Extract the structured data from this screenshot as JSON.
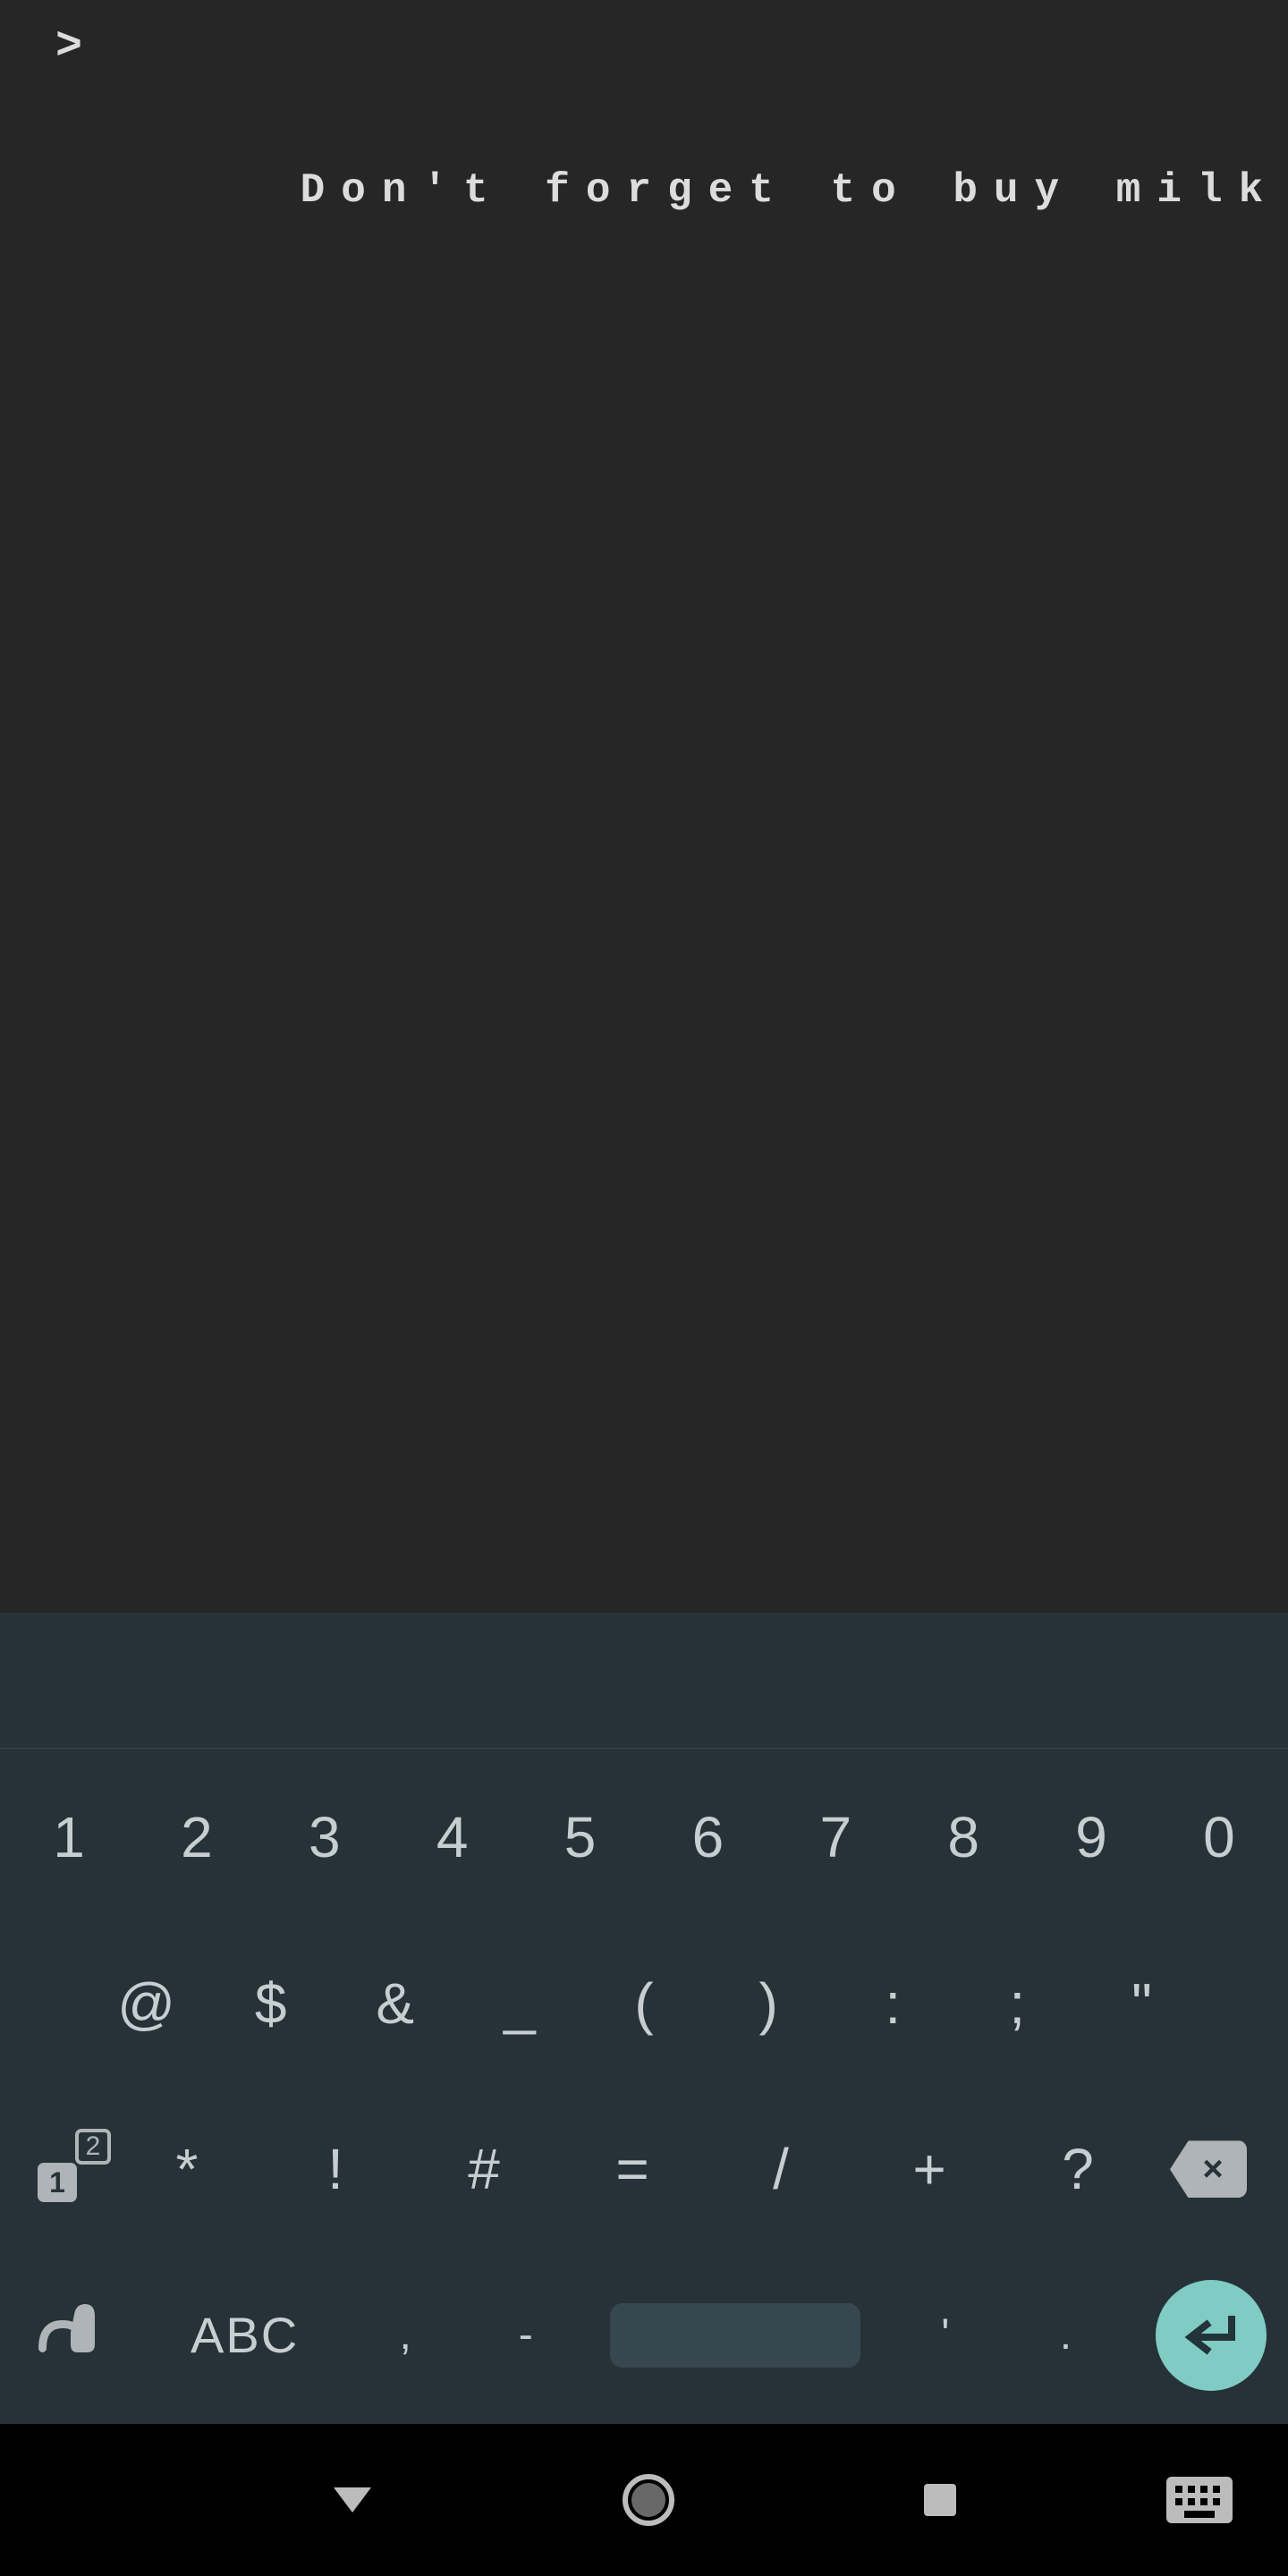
{
  "terminal": {
    "prompt": ">",
    "input": "Don't forget to buy milk!"
  },
  "keyboard": {
    "row1": [
      "1",
      "2",
      "3",
      "4",
      "5",
      "6",
      "7",
      "8",
      "9",
      "0"
    ],
    "row2": [
      "@",
      "$",
      "&",
      "_",
      "(",
      ")",
      ":",
      ";",
      "\""
    ],
    "row3": {
      "shift_main": "1",
      "shift_badge": "2",
      "keys": [
        "*",
        "!",
        "#",
        "=",
        "/",
        "+",
        "?"
      ],
      "backspace": "×"
    },
    "row4": {
      "swipe_icon": "swipe",
      "abc": "ABC",
      "comma": ",",
      "dash": "-",
      "space": " ",
      "apostrophe": "'",
      "period": ".",
      "enter": "↵"
    }
  },
  "colors": {
    "terminal_bg": "#262626",
    "keyboard_bg": "#263238",
    "key_text": "#c7ced1",
    "accent": "#80cbc4"
  }
}
